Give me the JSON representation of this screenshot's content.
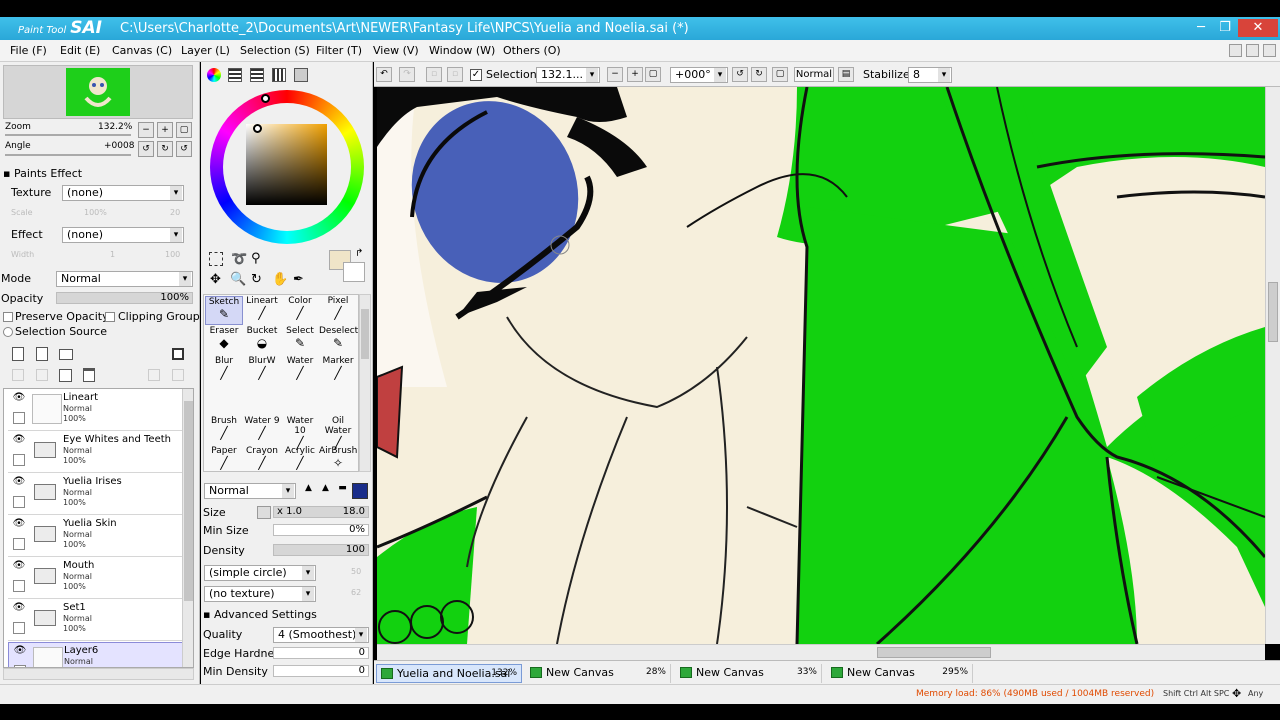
{
  "window": {
    "logo_small": "Paint Tool",
    "logo_big": "SAI",
    "title": "C:\\Users\\Charlotte_2\\Documents\\Art\\NEWER\\Fantasy Life\\NPCS\\Yuelia and Noelia.sai (*)",
    "minimize": "─",
    "restore": "❐",
    "close": "✕"
  },
  "menu": [
    "File (F)",
    "Edit (E)",
    "Canvas (C)",
    "Layer (L)",
    "Selection (S)",
    "Filter (T)",
    "View (V)",
    "Window (W)",
    "Others (O)"
  ],
  "navigator": {
    "zoom_label": "Zoom",
    "zoom_value": "132.2%",
    "angle_label": "Angle",
    "angle_value": "+0008"
  },
  "paints_effect": {
    "header": "Paints Effect",
    "texture_label": "Texture",
    "texture_value": "(none)",
    "scale_label": "Scale",
    "scale_value": "100%",
    "scale_num": "20",
    "effect_label": "Effect",
    "effect_value": "(none)",
    "width_label": "Width",
    "width_value": "1",
    "width_num": "100"
  },
  "layer_props": {
    "mode_label": "Mode",
    "mode_value": "Normal",
    "opacity_label": "Opacity",
    "opacity_value": "100%",
    "preserve_opacity": "Preserve Opacity",
    "clipping_group": "Clipping Group",
    "selection_source": "Selection Source"
  },
  "layers": [
    {
      "name": "Lineart",
      "mode": "Normal",
      "opacity": "100%",
      "type": "layer"
    },
    {
      "name": "Eye Whites and Teeth",
      "mode": "Normal",
      "opacity": "100%",
      "type": "folder"
    },
    {
      "name": "Yuelia Irises",
      "mode": "Normal",
      "opacity": "100%",
      "type": "folder"
    },
    {
      "name": "Yuelia Skin",
      "mode": "Normal",
      "opacity": "100%",
      "type": "folder"
    },
    {
      "name": "Mouth",
      "mode": "Normal",
      "opacity": "100%",
      "type": "folder"
    },
    {
      "name": "Set1",
      "mode": "Normal",
      "opacity": "100%",
      "type": "folder"
    },
    {
      "name": "Layer6",
      "mode": "Normal",
      "opacity": "",
      "type": "layer"
    }
  ],
  "tools": [
    {
      "label": "Sketch",
      "icon": "✎"
    },
    {
      "label": "Lineart",
      "icon": "╱"
    },
    {
      "label": "Color",
      "icon": "╱"
    },
    {
      "label": "Pixel",
      "icon": "╱"
    },
    {
      "label": "Eraser",
      "icon": "◆"
    },
    {
      "label": "Bucket",
      "icon": "◒"
    },
    {
      "label": "Select",
      "icon": "✎"
    },
    {
      "label": "Deselect",
      "icon": "✎"
    },
    {
      "label": "Blur",
      "icon": "╱"
    },
    {
      "label": "BlurW",
      "icon": "╱"
    },
    {
      "label": "Water",
      "icon": "╱"
    },
    {
      "label": "Marker",
      "icon": "╱"
    },
    {
      "label": "Brush",
      "icon": "╱"
    },
    {
      "label": "Water 9",
      "icon": "╱"
    },
    {
      "label": "Water 10",
      "icon": "╱"
    },
    {
      "label": "Oil Water",
      "icon": "╱"
    },
    {
      "label": "Paper",
      "icon": "╱"
    },
    {
      "label": "Crayon",
      "icon": "╱"
    },
    {
      "label": "Acrylic",
      "icon": "╱"
    },
    {
      "label": "AirBrush",
      "icon": "✧"
    }
  ],
  "brush": {
    "blend_value": "Normal",
    "size_label": "Size",
    "size_mult": "x 1.0",
    "size_value": "18.0",
    "min_size_label": "Min Size",
    "min_size_value": "0%",
    "density_label": "Density",
    "density_value": "100",
    "shape_value": "(simple circle)",
    "shape_num": "50",
    "texture_value": "(no texture)",
    "texture_num": "62",
    "advanced_label": "Advanced Settings",
    "quality_label": "Quality",
    "quality_value": "4 (Smoothest)",
    "edge_hardness_label": "Edge Hardness",
    "edge_hardness_value": "0",
    "min_density_label": "Min Density",
    "min_density_value": "0"
  },
  "toolbar": {
    "selection_label": "Selection",
    "zoom_value": "132.1...",
    "angle_value": "+000°",
    "mode_value": "Normal",
    "stabilizer_label": "Stabilizer",
    "stabilizer_value": "8"
  },
  "tabs": [
    {
      "name": "Yuelia and Noelia.sai",
      "zoom": "132%"
    },
    {
      "name": "New Canvas",
      "zoom": "28%"
    },
    {
      "name": "New Canvas",
      "zoom": "33%"
    },
    {
      "name": "New Canvas",
      "zoom": "295%"
    }
  ],
  "status": {
    "memory": "Memory load: 86% (490MB used / 1004MB reserved)",
    "keys": "Shift Ctrl Alt SPC",
    "any": "Any"
  },
  "colors": {
    "accent": "#2aa7d8",
    "canvas_hair": "#f6efdc",
    "canvas_dress": "#12d10f",
    "iris": "#4860b8",
    "current_color": "#f0e5c8"
  }
}
